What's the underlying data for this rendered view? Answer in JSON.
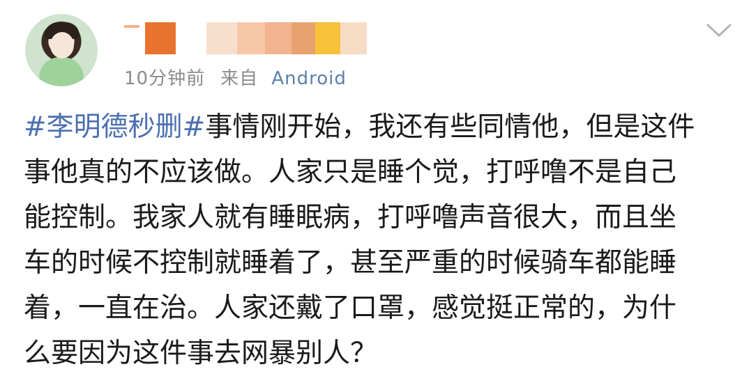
{
  "post": {
    "author": {
      "avatar_icon": "avatar-girl-icon",
      "name_blur_colors": [
        "#e8732e",
        "#f8dfcc",
        "#f6c8a8",
        "#f2b48f",
        "#e8a26f",
        "#f7c13a",
        "#f7dcc6"
      ]
    },
    "time": "10分钟前",
    "from_label": "来自",
    "source": "Android",
    "menu_icon": "chevron-down-icon",
    "hashtag": "#李明德秒删#",
    "lines": [
      "事情刚开始，我还有些同情他，但是这件",
      "事他真的不应该做。人家只是睡个觉，打呼噜不是自己",
      "能控制。我家人就有睡眠病，打呼噜声音很大，而且坐",
      "车的时候不控制就睡着了，甚至严重的时候骑车都能睡",
      "着，一直在治。人家还戴了口罩，感觉挺正常的，为什",
      "么要因为这件事去网暴别人？"
    ],
    "colors": {
      "hashtag": "#4b6fb0",
      "source": "#5b7fa8",
      "meta": "#8b8b8b",
      "text": "#1a1a1a"
    }
  }
}
